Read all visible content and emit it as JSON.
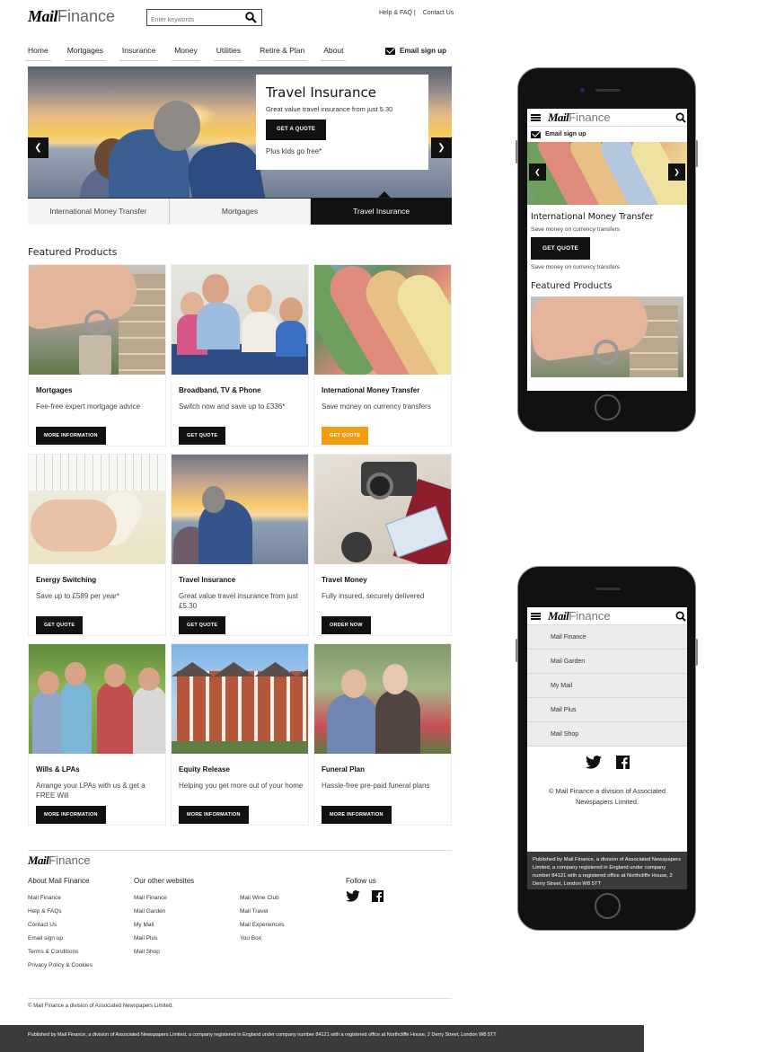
{
  "brand": {
    "logo_bold": "Mail",
    "logo_light": "Finance"
  },
  "search": {
    "placeholder": "Enter keywords"
  },
  "toplinks": {
    "help": "Help & FAQ |",
    "contact": "Contact Us"
  },
  "nav": [
    "Home",
    "Mortgages",
    "Insurance",
    "Money",
    "Utilities",
    "Retire & Plan",
    "About"
  ],
  "email_signup": "Email sign up",
  "hero": {
    "title": "Travel Insurance",
    "subtitle": "Great value travel insurance from just 5.30",
    "button": "GET A QUOTE",
    "note": "Plus kids go free*",
    "prev": "❮",
    "next": "❯"
  },
  "tabs": [
    "International Money Transfer",
    "Mortgages",
    "Travel Insurance"
  ],
  "featured_heading": "Featured Products",
  "products": [
    {
      "title": "Mortgages",
      "desc": "Fee-free expert mortgage advice",
      "button": "MORE INFORMATION"
    },
    {
      "title": "Broadband, TV & Phone",
      "desc": "Switch now and save up to £336*",
      "button": "GET QUOTE"
    },
    {
      "title": "International Money Transfer",
      "desc": "Save money on currency transfers",
      "button": "GET QUOTE"
    },
    {
      "title": "Energy Switching",
      "desc": "Save up to £589 per year*",
      "button": "GET QUOTE"
    },
    {
      "title": "Travel Insurance",
      "desc": "Great value travel insurance from just £5.30",
      "button": "GET QUOTE"
    },
    {
      "title": "Travel Money",
      "desc": "Fully insured, securely delivered",
      "button": "ORDER NOW"
    },
    {
      "title": "Wills & LPAs",
      "desc": "Arrange your LPAs with us & get a FREE Will",
      "button": "MORE INFORMATION"
    },
    {
      "title": "Equity Release",
      "desc": "Helping you get more out of your home",
      "button": "MORE INFORMATION"
    },
    {
      "title": "Funeral Plan",
      "desc": "Hassle-free pre-paid funeral plans",
      "button": "MORE INFORMATION"
    }
  ],
  "footer": {
    "about_heading": "About Mail Finance",
    "about_links": [
      "Mail Finance",
      "Help & FAQs",
      "Contact Us",
      "Email sign up",
      "Terms & Conditions",
      "Privacy Policy & Cookies"
    ],
    "other_heading": "Our other websites",
    "other_col1": [
      "Mail Finance",
      "Mail Garden",
      "My Mail",
      "Mail Plus",
      "Mail Shop"
    ],
    "other_col2": [
      "Mail Wine Club",
      "Mail Travel",
      "Mail Experiences",
      "You Box"
    ],
    "follow_heading": "Follow us",
    "copyright": "© Mail Finance a division of Associated Newspapers Limited.",
    "legal": "Published by Mail Finance, a division of Associated Newspapers Limited, a company registered in England under company number 84121 with a registered office at Northcliffe House, 2 Derry Street, London W8 5TT"
  },
  "mobile1": {
    "email_signup": "Email sign up",
    "title": "International Money Transfer",
    "sub": "Save money on currency transfers",
    "button": "GET QUOTE",
    "sub2": "Save money on currency transfers",
    "featured": "Featured Products",
    "prev": "❮",
    "next": "❯"
  },
  "mobile2": {
    "menu": [
      "Mail Finance",
      "Mail Garden",
      "My Mail",
      "Mail Plus",
      "Mail Shop"
    ],
    "copyright": "© Mail Finance a division of Associated Newspapers Limited.",
    "legal": "Published by Mail Finance, a division of Associated Newspapers Limited, a company registered in England under company number 84121 with a registered office at Northcliffe House, 2 Derry Street, London W8 5TT"
  },
  "colors": {
    "accent_orange": "#f39c12",
    "dark": "#111111",
    "footer_bar": "#3b3b3b"
  }
}
